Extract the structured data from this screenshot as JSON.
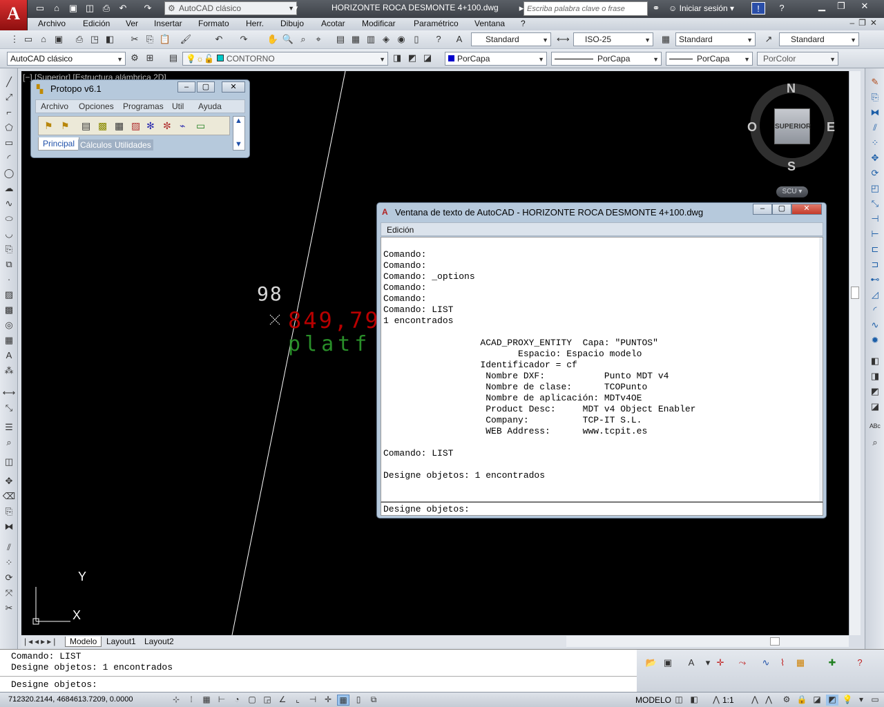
{
  "window": {
    "title": "HORIZONTE ROCA  DESMONTE 4+100.dwg",
    "app_logo": "A",
    "workspace": "AutoCAD clásico",
    "search_placeholder": "Escriba palabra clave o frase",
    "signin": "Iniciar sesión"
  },
  "menubar": [
    "Archivo",
    "Edición",
    "Ver",
    "Insertar",
    "Formato",
    "Herr.",
    "Dibujo",
    "Acotar",
    "Modificar",
    "Paramétrico",
    "Ventana",
    "?"
  ],
  "styles": {
    "text_style": "Standard",
    "dim_style": "ISO-25",
    "table_style": "Standard",
    "mleader_style": "Standard"
  },
  "layers": {
    "workspace_combo": "AutoCAD clásico",
    "current_layer": "CONTORNO",
    "color": "PorCapa",
    "linetype": "PorCapa",
    "lineweight": "PorCapa",
    "plotstyle": "PorColor"
  },
  "viewport": {
    "label": "[−] [Superior] [Estructura alámbrica 2D]",
    "cube_face": "SUPERIOR",
    "compass": {
      "n": "N",
      "s": "S",
      "e": "E",
      "w": "O"
    },
    "ucs_button": "SCU",
    "ucs_x": "X",
    "ucs_y": "Y",
    "point_number": "98",
    "point_elevation": "849,79",
    "point_code": "platf"
  },
  "protopo": {
    "title": "Protopo v6.1",
    "menu": [
      "Archivo",
      "Opciones",
      "Programas",
      "Util",
      "Ayuda"
    ],
    "tabs": [
      "Principal",
      "Cálculos",
      "Utilidades"
    ]
  },
  "textwindow": {
    "title": "Ventana de texto de AutoCAD - HORIZONTE ROCA  DESMONTE 4+100.dwg",
    "menu": "Edición",
    "lines": "Comando:\nComando:\nComando: _options\nComando:\nComando:\nComando: LIST\n1 encontrados\n\n                  ACAD_PROXY_ENTITY  Capa: \"PUNTOS\"\n                         Espacio: Espacio modelo\n                  Identificador = cf\n                   Nombre DXF:           Punto MDT v4\n                   Nombre de clase:      TCOPunto\n                   Nombre de aplicación: MDTv4OE\n                   Product Desc:     MDT v4 Object Enabler\n                   Company:          TCP-IT S.L.\n                   WEB Address:      www.tcpit.es\n\nComando: LIST\n\nDesigne objetos: 1 encontrados",
    "prompt": "Designe objetos:"
  },
  "layout_tabs": [
    "Modelo",
    "Layout1",
    "Layout2"
  ],
  "command_line": {
    "line1": "Comando: LIST",
    "line2": "Designe objetos: 1 encontrados",
    "prompt": "Designe objetos:"
  },
  "status": {
    "coords": "712320.2144, 4684613.7209, 0.0000",
    "space": "MODELO",
    "scale": "1:1"
  },
  "colors": {
    "canvas": "#000000",
    "point_number": "#ffffff",
    "point_elevation": "#cc0000",
    "point_code": "#2e9e2e",
    "close_button": "#c9493b"
  }
}
